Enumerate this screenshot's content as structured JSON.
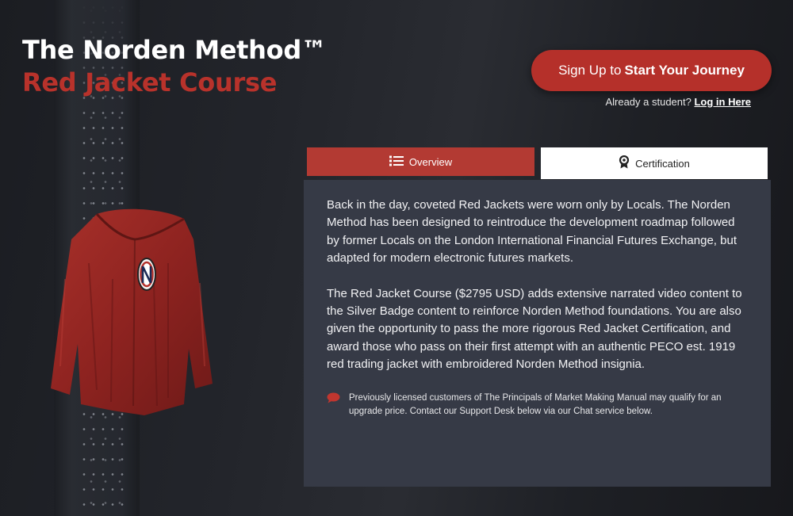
{
  "header": {
    "title": "The Norden Method™",
    "subtitle": "Red Jacket Course"
  },
  "cta": {
    "prefix": "Sign Up to",
    "emphasis": "Start Your Journey"
  },
  "login": {
    "prompt": "Already a student?",
    "link_label": "Log in Here"
  },
  "tabs": [
    {
      "label": "Overview",
      "icon": "list-icon",
      "active": true
    },
    {
      "label": "Certification",
      "icon": "award-icon",
      "active": false
    }
  ],
  "overview": {
    "paragraph_1": "Back in the day, coveted Red Jackets were worn only by Locals. The Norden Method has been designed to reintroduce the development roadmap followed by former Locals on the London International Financial Futures Exchange, but adapted for modern electronic futures markets.",
    "paragraph_2": "The Red Jacket Course ($2795 USD) adds extensive narrated video content to the Silver Badge content to reinforce Norden Method foundations.  You are also given the opportunity to pass the more rigorous Red Jacket Certification, and award those who pass on their first attempt with an authentic PECO est. 1919 red trading jacket with embroidered Norden Method insignia.",
    "note": "Previously licensed customers of The Principals of Market Making Manual may qualify for an upgrade price.  Contact our Support Desk below via our Chat service below.",
    "note_icon": "chat-bubble-icon"
  },
  "colors": {
    "accent_red": "#b5302a",
    "tab_active": "#b33a33",
    "panel_bg": "#363a46"
  }
}
